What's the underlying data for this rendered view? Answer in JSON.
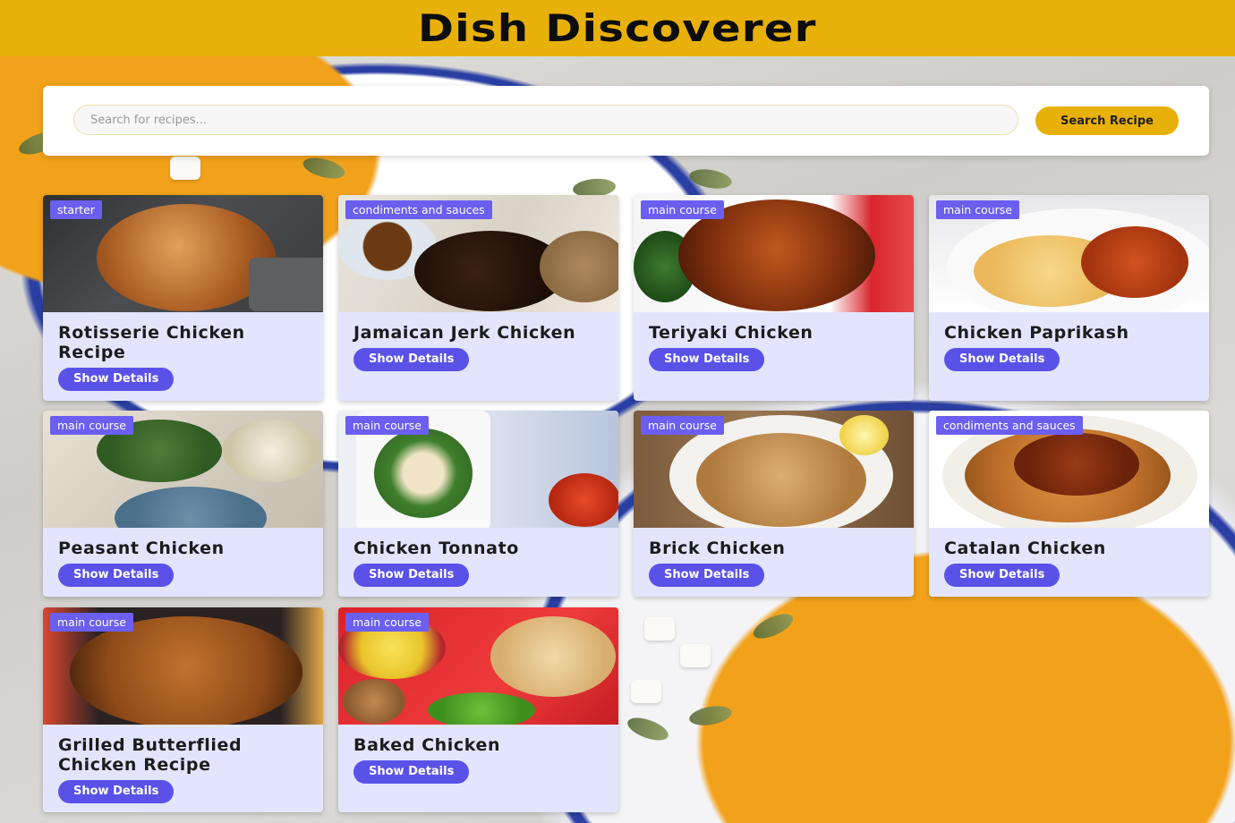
{
  "header": {
    "title": "Dish Discoverer"
  },
  "search": {
    "placeholder": "Search for recipes...",
    "value": "",
    "button_label": "Search Recipe"
  },
  "recipes": [
    {
      "category": "starter",
      "title": "Rotisserie Chicken Recipe",
      "button": "Show Details"
    },
    {
      "category": "condiments and sauces",
      "title": "Jamaican Jerk Chicken",
      "button": "Show Details"
    },
    {
      "category": "main course",
      "title": "Teriyaki Chicken",
      "button": "Show Details"
    },
    {
      "category": "main course",
      "title": "Chicken Paprikash",
      "button": "Show Details"
    },
    {
      "category": "main course",
      "title": "Peasant Chicken",
      "button": "Show Details"
    },
    {
      "category": "main course",
      "title": "Chicken Tonnato",
      "button": "Show Details"
    },
    {
      "category": "main course",
      "title": "Brick Chicken",
      "button": "Show Details"
    },
    {
      "category": "condiments and sauces",
      "title": "Catalan Chicken",
      "button": "Show Details"
    },
    {
      "category": "main course",
      "title": "Grilled Butterflied Chicken Recipe",
      "button": "Show Details"
    },
    {
      "category": "main course",
      "title": "Baked Chicken",
      "button": "Show Details"
    }
  ],
  "colors": {
    "header_bg": "#e8b10a",
    "badge": "#6a5ff0",
    "button": "#5a52e8",
    "card_bg": "#e3e5ff"
  }
}
